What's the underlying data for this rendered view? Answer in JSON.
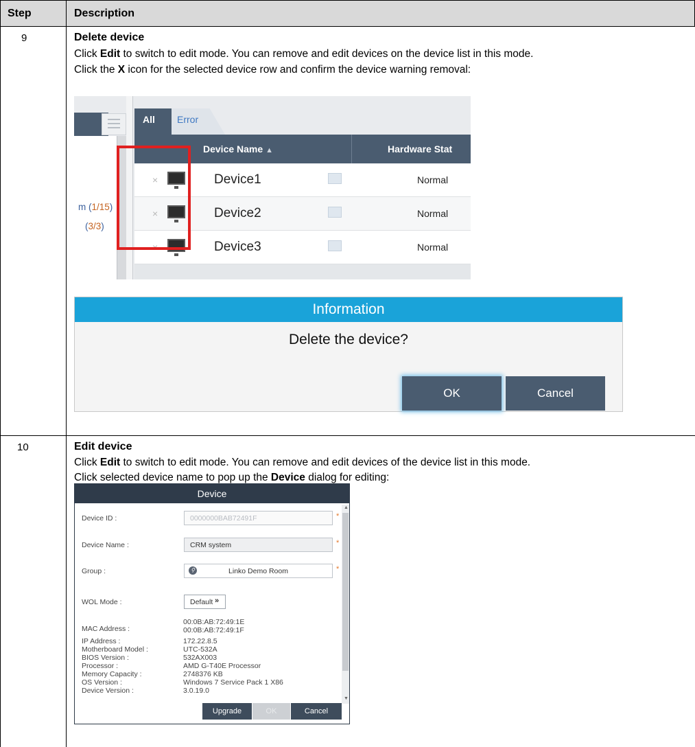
{
  "table": {
    "header_step": "Step",
    "header_description": "Description"
  },
  "step9": {
    "number": "9",
    "title": "Delete device",
    "line1_pre": "Click ",
    "line1_bold": "Edit",
    "line1_post": " to switch to edit mode. You can remove and edit devices on the device list in this mode.",
    "line2_pre": "Click the ",
    "line2_bold": "X",
    "line2_post": " icon for the selected device row and confirm the device warning removal:"
  },
  "device_list": {
    "tab_all": "All",
    "tab_error": "Error",
    "col_device_name": "Device Name",
    "sort_indicator": "▲",
    "col_hardware_status": "Hardware Stat",
    "tree_item1_prefix": "m (",
    "tree_item1_count": "1/15",
    "tree_item1_suffix": ")",
    "tree_item2_prefix": "(",
    "tree_item2_count": "3/3",
    "tree_item2_suffix": ")",
    "rows": [
      {
        "name": "Device1",
        "status": "Normal"
      },
      {
        "name": "Device2",
        "status": "Normal"
      },
      {
        "name": "Device3",
        "status": "Normal"
      }
    ],
    "remove_icon": "×"
  },
  "info_dialog": {
    "title": "Information",
    "message": "Delete the device?",
    "ok": "OK",
    "cancel": "Cancel"
  },
  "step10": {
    "number": "10",
    "title": "Edit device",
    "line1_pre": "Click ",
    "line1_bold": "Edit",
    "line1_post": " to switch to edit mode. You can remove and edit devices of the device list in this mode.",
    "line2_pre": "Click selected device name to pop up the ",
    "line2_bold": "Device",
    "line2_post": " dialog for editing:"
  },
  "device_dialog": {
    "title": "Device",
    "device_id_label": "Device ID :",
    "device_id_value": "0000000BAB72491F",
    "device_name_label": "Device Name :",
    "device_name_value": "CRM system",
    "group_label": "Group :",
    "group_value": "Linko Demo Room",
    "wol_label": "WOL Mode :",
    "wol_value": "Default",
    "required_mark": "*",
    "mac_label": "MAC Address :",
    "mac_value1": "00:0B:AB:72:49:1E",
    "mac_value2": "00:0B:AB:72:49:1F",
    "ip_label": "IP Address :",
    "ip_value": "172.22.8.5",
    "mb_label": "Motherboard Model :",
    "mb_value": "UTC-532A",
    "bios_label": "BIOS Version :",
    "bios_value": "532AX003",
    "proc_label": "Processor :",
    "proc_value": "AMD G-T40E Processor",
    "mem_label": "Memory Capacity :",
    "mem_value": "2748376 KB",
    "os_label": "OS Version :",
    "os_value": "Windows 7 Service Pack 1 X86",
    "dev_ver_label": "Device Version :",
    "dev_ver_value": "3.0.19.0",
    "btn_upgrade": "Upgrade",
    "btn_ok": "OK",
    "btn_cancel": "Cancel"
  }
}
